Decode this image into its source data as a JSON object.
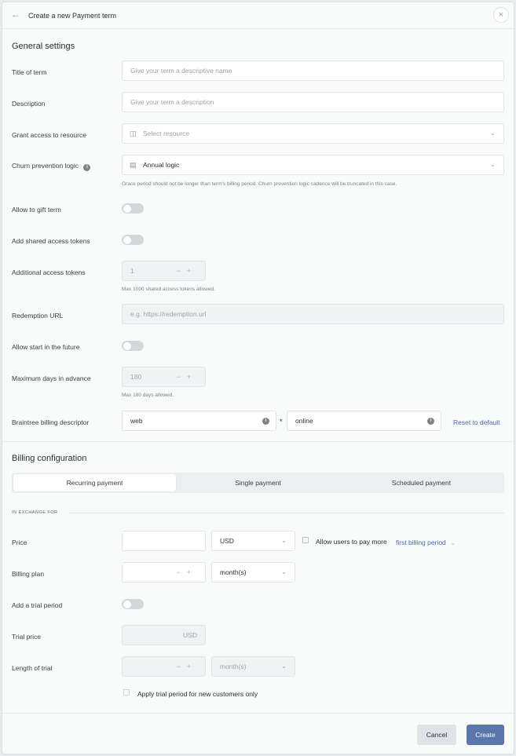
{
  "header": {
    "back_icon": "arrow-left-icon",
    "title": "Create a new Payment term",
    "close_icon": "close-icon"
  },
  "general": {
    "title": "General settings",
    "title_of_term": {
      "label": "Title of term",
      "placeholder": "Give your term a descriptive name"
    },
    "description": {
      "label": "Description",
      "placeholder": "Give your term a description"
    },
    "resource": {
      "label": "Grant access to resource",
      "placeholder": "Select resource"
    },
    "churn": {
      "label": "Churn prevention logic",
      "value": "Annual logic",
      "hint": "Grace period should not be longer than term's billing period. Churn prevention logic cadence will be truncated in this case."
    },
    "gift": {
      "label": "Allow to gift term"
    },
    "shared": {
      "label": "Add shared access tokens"
    },
    "additional": {
      "label": "Additional access tokens",
      "value": "1",
      "hint": "Max 1000 shared access tokens allowed."
    },
    "redemption": {
      "label": "Redemption URL",
      "placeholder": "e.g. https://redemption.url"
    },
    "future": {
      "label": "Allow start in the future"
    },
    "maxdays": {
      "label": "Maximum days in advance",
      "value": "180",
      "hint": "Max 180 days allowed."
    },
    "braintree": {
      "label": "Braintree billing descriptor",
      "part1": "web",
      "separator": "*",
      "part2": "online",
      "reset": "Reset to default"
    }
  },
  "billing": {
    "title": "Billing configuration",
    "tabs": [
      "Recurring payment",
      "Single payment",
      "Scheduled payment"
    ],
    "exchange": "IN EXCHANGE FOR",
    "price": {
      "label": "Price",
      "currency": "USD",
      "allow_more": "Allow users to pay more",
      "period": "first billing period"
    },
    "plan": {
      "label": "Billing plan",
      "unit": "month(s)"
    },
    "trial": {
      "label": "Add a trial period"
    },
    "trial_price": {
      "label": "Trial price",
      "currency": "USD"
    },
    "trial_length": {
      "label": "Length of trial",
      "unit": "month(s)"
    },
    "new_only": "Apply trial period for new customers only"
  },
  "footer": {
    "cancel": "Cancel",
    "create": "Create"
  }
}
